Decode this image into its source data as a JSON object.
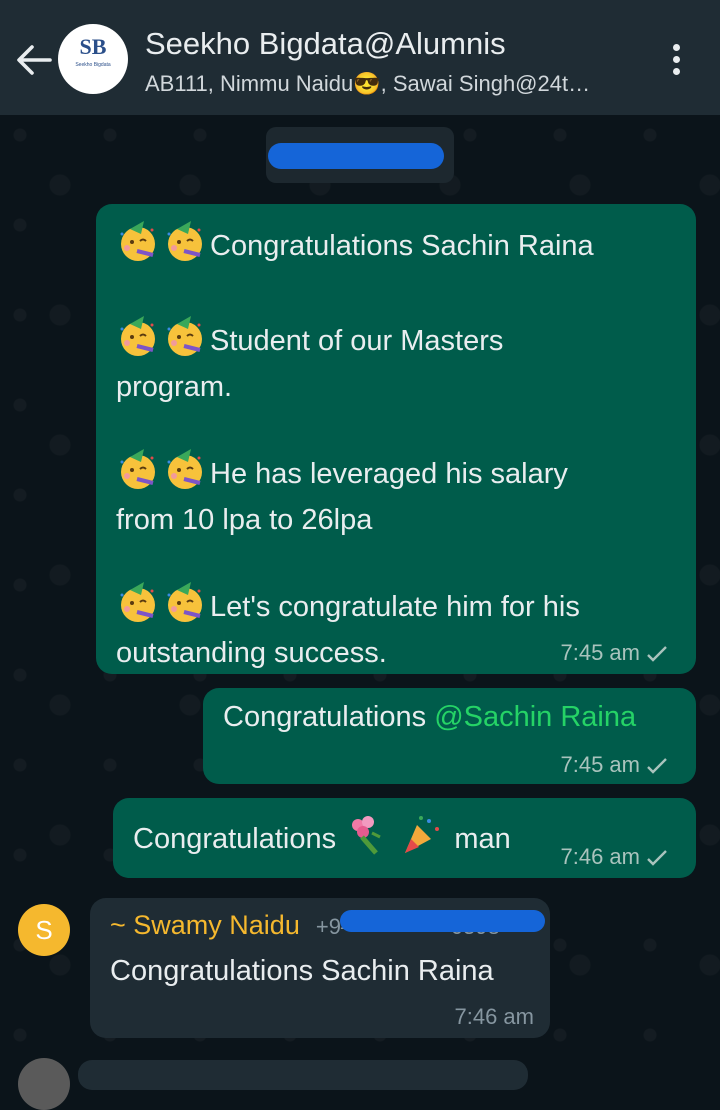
{
  "header": {
    "group_name": "Seekho Bigdata@Alumnis",
    "participants": "AB111, Nimmu Naidu😎, Sawai Singh@24t…",
    "avatar_logo": "SB",
    "avatar_logo_sub": "Seekho Bigdata"
  },
  "messages": [
    {
      "lines": [
        "Congratulations Sachin Raina",
        "Student of our Masters",
        "program.",
        "He has leveraged his salary",
        "from 10 lpa to 26lpa",
        "Let's congratulate him for his",
        "outstanding success."
      ],
      "time": "7:45 am"
    },
    {
      "text": "Congratulations ",
      "mention": "@Sachin Raina",
      "time": "7:45 am"
    },
    {
      "text_before": "Congratulations",
      "text_after": "man",
      "time": "7:46 am"
    },
    {
      "sender_initial": "S",
      "sender": "~ Swamy Naidu",
      "sender_phone": "+9—————0598",
      "text": "Congratulations Sachin Raina",
      "time": "7:46 am"
    }
  ],
  "icons": [
    "back-arrow-icon",
    "more-vert-icon",
    "double-check-icon",
    "partying-face-emoji",
    "bouquet-emoji",
    "party-popper-emoji"
  ],
  "colors": {
    "header_bg": "#1f2c34",
    "outgoing_bubble": "#005c4b",
    "incoming_bubble": "#1f2c34",
    "mention": "#25d366",
    "sender_name": "#f5b82e"
  }
}
